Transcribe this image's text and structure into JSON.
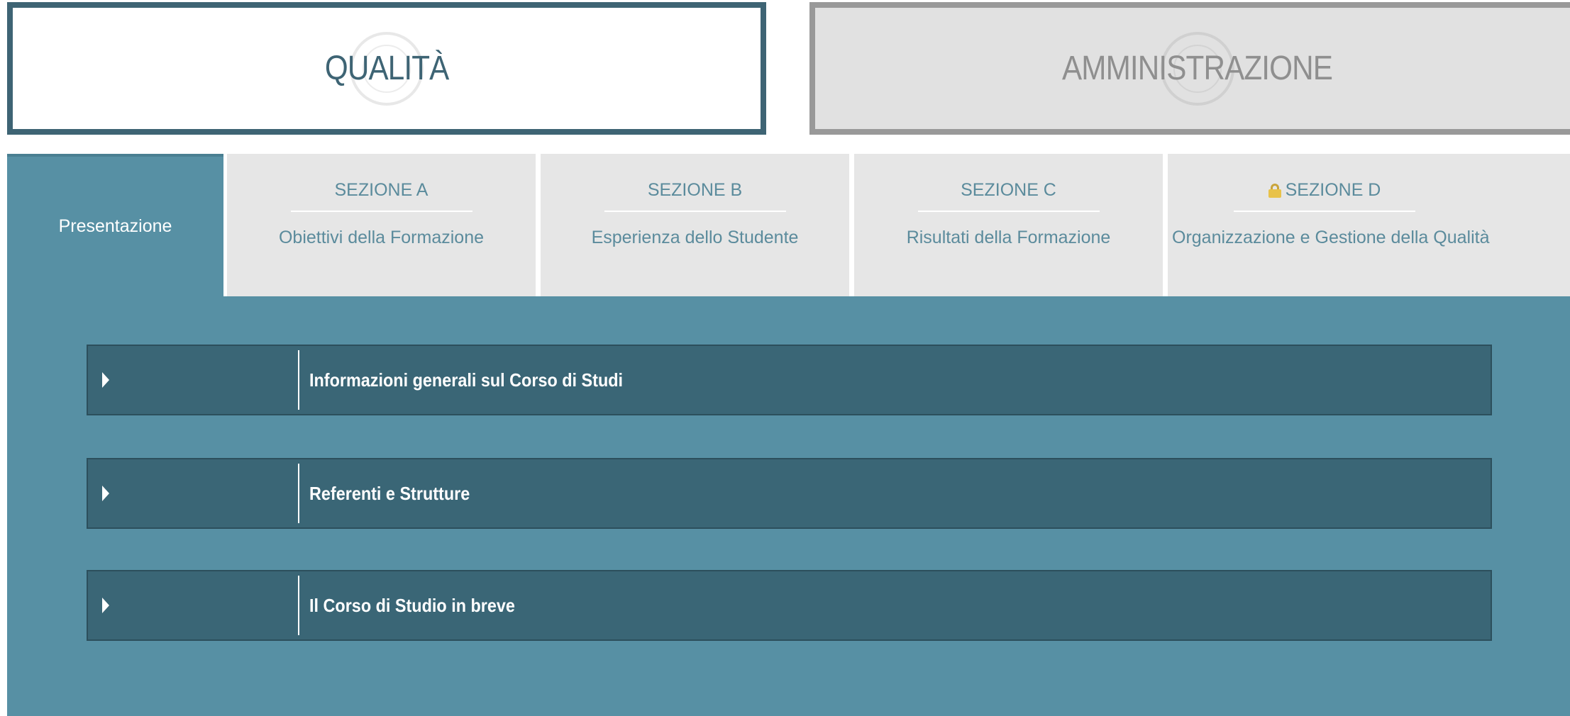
{
  "top_nav": {
    "qualita": "QUALITÀ",
    "amministrazione": "AMMINISTRAZIONE"
  },
  "tabs": [
    {
      "heading": "",
      "subtitle": "Presentazione",
      "active": true
    },
    {
      "heading": "SEZIONE A",
      "subtitle": "Obiettivi della Formazione",
      "active": false
    },
    {
      "heading": "SEZIONE B",
      "subtitle": "Esperienza dello Studente",
      "active": false
    },
    {
      "heading": "SEZIONE C",
      "subtitle": "Risultati della Formazione",
      "active": false
    },
    {
      "heading": "SEZIONE D",
      "subtitle": "Organizzazione e Gestione della Qualità",
      "active": false,
      "icon": "lock-icon"
    }
  ],
  "accordion": [
    {
      "title": "Informazioni generali sul Corso di Studi",
      "icon": "caret-right-icon"
    },
    {
      "title": "Referenti e Strutture",
      "icon": "caret-right-icon"
    },
    {
      "title": "Il Corso di Studio in breve",
      "icon": "caret-right-icon"
    }
  ],
  "colors": {
    "accent": "#5790a4",
    "accordion_bg": "#3a6676",
    "tab_inactive": "#e6e6e6",
    "lock": "#e8c24a"
  }
}
